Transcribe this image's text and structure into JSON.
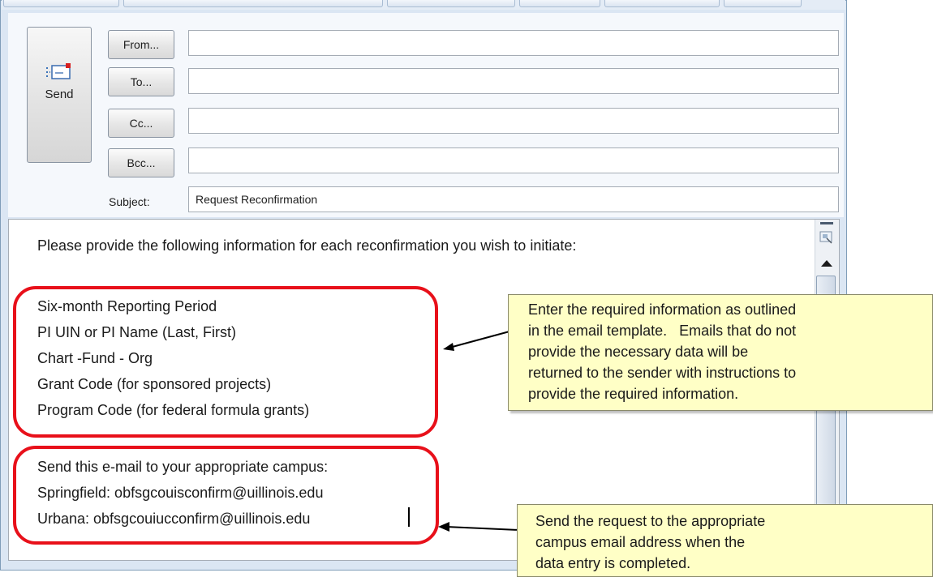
{
  "compose": {
    "send_label": "Send",
    "buttons": {
      "from": "From...",
      "to": "To...",
      "cc": "Cc...",
      "bcc": "Bcc..."
    },
    "fields": {
      "from": "",
      "to": "",
      "cc": "",
      "bcc": ""
    },
    "subject_label": "Subject:",
    "subject_value": "Request Reconfirmation"
  },
  "body": {
    "intro": "Please provide the following information for each reconfirmation you wish to initiate:",
    "required_fields": [
      "Six-month Reporting Period",
      "PI UIN or PI Name (Last, First)",
      "Chart -Fund - Org",
      "Grant Code (for sponsored projects)",
      "Program Code (for federal formula grants)"
    ],
    "send_to_heading": "Send this e-mail to your appropriate campus:",
    "addresses": [
      "Springfield: obfsgcouisconfirm@uillinois.edu",
      "Urbana: obfsgcouiucconfirm@uillinois.edu"
    ]
  },
  "callouts": {
    "note1": [
      "Enter the required information as outlined",
      "in the email template.   Emails that do not",
      "provide the necessary data will be",
      "returned to the sender with instructions to",
      "provide the required information."
    ],
    "note2": [
      "Send the request to the appropriate",
      "campus email address when the",
      "data entry is completed."
    ]
  },
  "colors": {
    "highlight": "#e8101a",
    "note_bg": "#ffffc6",
    "window_frame": "#dbe6f3"
  },
  "icons": [
    "send-envelope-icon",
    "format-icon",
    "scroll-up-icon"
  ]
}
